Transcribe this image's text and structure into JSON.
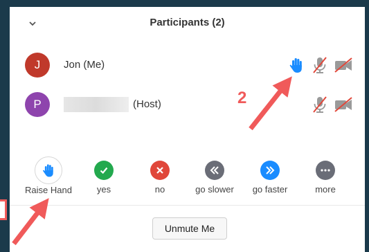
{
  "panel": {
    "title": "Participants (2)",
    "collapse_icon": "chevron-down-icon"
  },
  "participants": [
    {
      "initial": "J",
      "name": "Jon (Me)",
      "avatar_color": "#c0392b",
      "hand_raised": true
    },
    {
      "initial": "P",
      "name": "",
      "role": "(Host)",
      "avatar_color": "#8e44ad",
      "hand_raised": false
    }
  ],
  "reactions": [
    {
      "label": "Raise Hand",
      "icon": "hand-icon",
      "color": "#1a8cff"
    },
    {
      "label": "yes",
      "icon": "check-icon",
      "color": "#23a94e"
    },
    {
      "label": "no",
      "icon": "x-icon",
      "color": "#e0473a"
    },
    {
      "label": "go slower",
      "icon": "rewind-icon",
      "color": "#6a6d77"
    },
    {
      "label": "go faster",
      "icon": "fast-forward-icon",
      "color": "#1a8cff"
    },
    {
      "label": "more",
      "icon": "more-icon",
      "color": "#6a6d77"
    }
  ],
  "footer": {
    "unmute_label": "Unmute Me"
  },
  "annotations": {
    "number_label": "2",
    "arrow_color": "#f05a5a"
  }
}
